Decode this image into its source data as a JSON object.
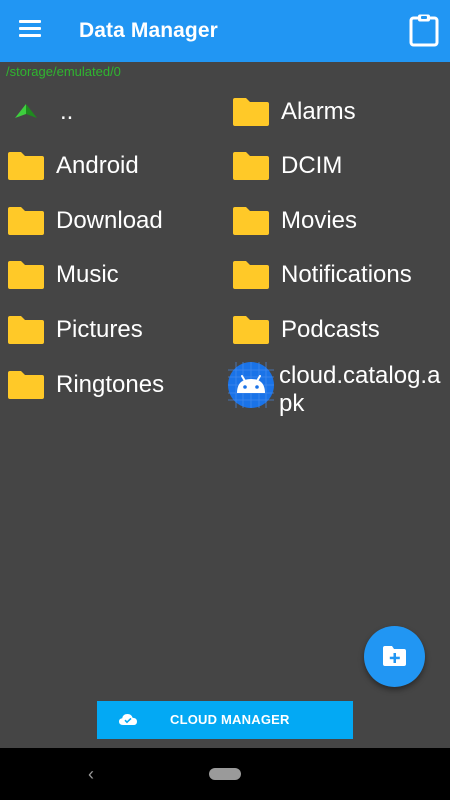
{
  "appbar": {
    "title": "Data Manager",
    "menu_icon": "menu-icon",
    "clipboard_icon": "clipboard-icon"
  },
  "path": "/storage/emulated/0",
  "items": [
    {
      "label": "..",
      "icon": "up-arrow-icon"
    },
    {
      "label": "Alarms",
      "icon": "folder-icon"
    },
    {
      "label": "Android",
      "icon": "folder-icon"
    },
    {
      "label": "DCIM",
      "icon": "folder-icon"
    },
    {
      "label": "Download",
      "icon": "folder-icon"
    },
    {
      "label": "Movies",
      "icon": "folder-icon"
    },
    {
      "label": "Music",
      "icon": "folder-icon"
    },
    {
      "label": "Notifications",
      "icon": "folder-icon"
    },
    {
      "label": "Pictures",
      "icon": "folder-icon"
    },
    {
      "label": "Podcasts",
      "icon": "folder-icon"
    },
    {
      "label": "Ringtones",
      "icon": "folder-icon"
    },
    {
      "label": "cloud.catalog.apk",
      "icon": "android-apk-icon"
    }
  ],
  "fab": {
    "icon": "new-folder-icon"
  },
  "cloud_button": {
    "label": "CLOUD MANAGER",
    "icon": "cloud-icon"
  },
  "nav": {
    "back_icon": "back-icon",
    "home_icon": "home-pill-icon"
  },
  "colors": {
    "primary": "#2196f3",
    "background": "#454545",
    "folder": "#ffc928",
    "path": "#2fb52f",
    "cloud_button": "#03a9f4"
  }
}
